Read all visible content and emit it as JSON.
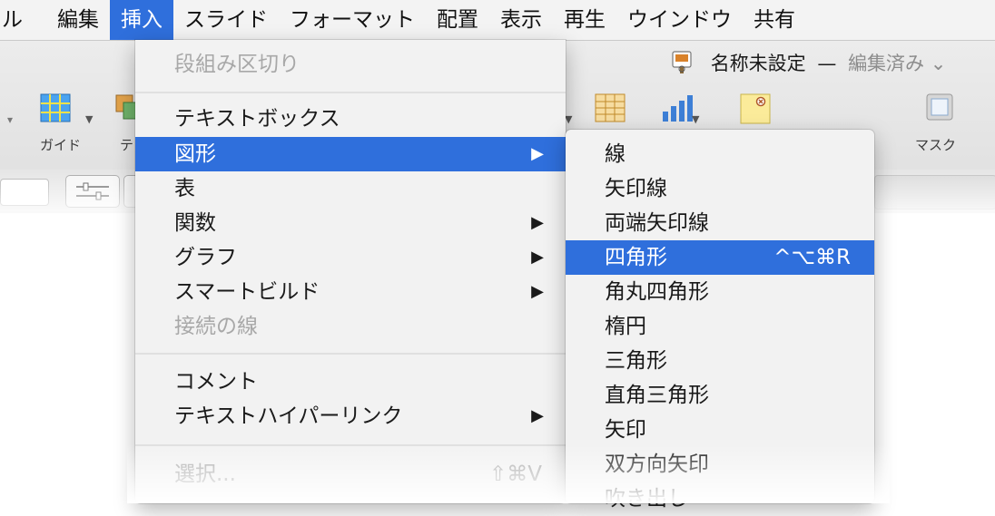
{
  "menubar": {
    "items": [
      {
        "label": "ル"
      },
      {
        "label": "編集"
      },
      {
        "label": "挿入"
      },
      {
        "label": "スライド"
      },
      {
        "label": "フォーマット"
      },
      {
        "label": "配置"
      },
      {
        "label": "表示"
      },
      {
        "label": "再生"
      },
      {
        "label": "ウインドウ"
      },
      {
        "label": "共有"
      }
    ],
    "active_index": 2,
    "active_color": "#2f6fdc"
  },
  "document": {
    "name": "名称未設定",
    "dash": "—",
    "status": "編集済み",
    "status_caret": "⌄",
    "icon": "keynote-document-icon"
  },
  "toolbar": {
    "guide_label": "ガイド",
    "te_label": "テ",
    "mask_label": "マスク",
    "icons": [
      "grid-guide-icon",
      "shapes-icon",
      "table-icon",
      "chart-icon",
      "comment-icon",
      "mask-icon"
    ]
  },
  "insert_menu": {
    "items": [
      {
        "label": "段組み区切り",
        "disabled": true
      },
      {
        "label": "テキストボックス"
      },
      {
        "label": "図形",
        "arrow": "▶",
        "highlighted": true
      },
      {
        "label": "表"
      },
      {
        "label": "関数",
        "arrow": "▶"
      },
      {
        "label": "グラフ",
        "arrow": "▶"
      },
      {
        "label": "スマートビルド",
        "arrow": "▶"
      },
      {
        "label": "接続の線",
        "disabled": true
      },
      {
        "label": "コメント"
      },
      {
        "label": "テキストハイパーリンク",
        "arrow": "▶"
      },
      {
        "label": "選択...",
        "disabled": true,
        "shortcut": "⇧⌘V"
      }
    ]
  },
  "shape_submenu": {
    "items": [
      {
        "label": "線"
      },
      {
        "label": "矢印線"
      },
      {
        "label": "両端矢印線"
      },
      {
        "label": "四角形",
        "shortcut": "^⌥⌘R",
        "highlighted": true
      },
      {
        "label": "角丸四角形"
      },
      {
        "label": "楕円"
      },
      {
        "label": "三角形"
      },
      {
        "label": "直角三角形"
      },
      {
        "label": "矢印"
      },
      {
        "label": "双方向矢印"
      },
      {
        "label": "吹き出し"
      }
    ]
  }
}
